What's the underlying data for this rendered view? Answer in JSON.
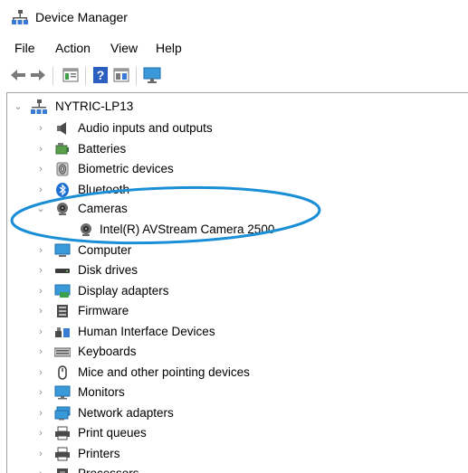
{
  "window": {
    "title": "Device Manager"
  },
  "menu": {
    "items": [
      "File",
      "Action",
      "View",
      "Help"
    ]
  },
  "toolbar": {
    "buttons": [
      "back-arrow-icon",
      "forward-arrow-icon",
      "properties-icon",
      "help-icon",
      "update-driver-icon",
      "monitor-scan-icon"
    ]
  },
  "tree": {
    "root": "NYTRIC-LP13",
    "categories": [
      {
        "label": "Audio inputs and outputs",
        "icon": "speaker-icon",
        "expanded": false
      },
      {
        "label": "Batteries",
        "icon": "battery-icon",
        "expanded": false
      },
      {
        "label": "Biometric devices",
        "icon": "fingerprint-icon",
        "expanded": false
      },
      {
        "label": "Bluetooth",
        "icon": "bluetooth-icon",
        "expanded": false
      },
      {
        "label": "Cameras",
        "icon": "webcam-icon",
        "expanded": true
      },
      {
        "label": "Intel(R) AVStream Camera 2500",
        "icon": "webcam-icon",
        "child": true
      },
      {
        "label": "Computer",
        "icon": "computer-icon",
        "expanded": false
      },
      {
        "label": "Disk drives",
        "icon": "disk-drive-icon",
        "expanded": false
      },
      {
        "label": "Display adapters",
        "icon": "display-adapter-icon",
        "expanded": false
      },
      {
        "label": "Firmware",
        "icon": "firmware-icon",
        "expanded": false
      },
      {
        "label": "Human Interface Devices",
        "icon": "hid-icon",
        "expanded": false
      },
      {
        "label": "Keyboards",
        "icon": "keyboard-icon",
        "expanded": false
      },
      {
        "label": "Mice and other pointing devices",
        "icon": "mouse-icon",
        "expanded": false
      },
      {
        "label": "Monitors",
        "icon": "monitor-icon",
        "expanded": false
      },
      {
        "label": "Network adapters",
        "icon": "network-adapter-icon",
        "expanded": false
      },
      {
        "label": "Print queues",
        "icon": "printer-icon",
        "expanded": false
      },
      {
        "label": "Printers",
        "icon": "printer-icon",
        "expanded": false
      },
      {
        "label": "Processors",
        "icon": "processor-icon",
        "expanded": false
      }
    ]
  },
  "annotation": {
    "color": "#1a8fd6"
  }
}
